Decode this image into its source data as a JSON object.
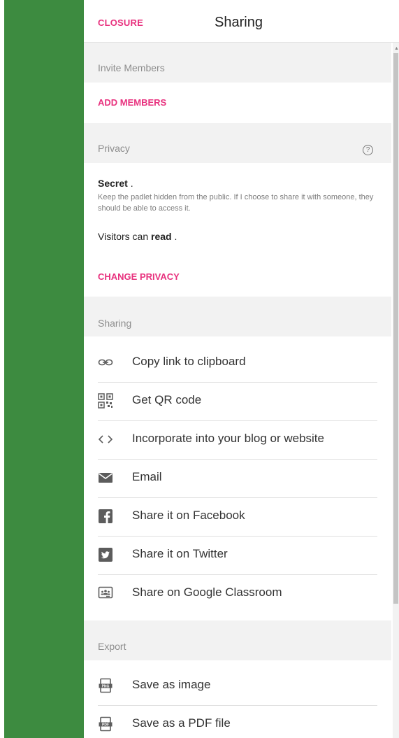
{
  "header": {
    "close_label": "CLOSURE",
    "title": "Sharing"
  },
  "invite": {
    "section_label": "Invite Members",
    "add_members": "ADD MEMBERS"
  },
  "privacy": {
    "section_label": "Privacy",
    "help_glyph": "?",
    "level": "Secret",
    "level_suffix": " .",
    "description": "Keep the padlet hidden from the public. If I choose to share it with someone, they should be able to access it.",
    "visitors_prefix": "Visitors can ",
    "visitors_value": "read",
    "visitors_suffix": " .",
    "change_label": "CHANGE PRIVACY"
  },
  "sharing": {
    "section_label": "Sharing",
    "items": [
      {
        "label": "Copy link to clipboard",
        "icon": "link-icon"
      },
      {
        "label": "Get QR code",
        "icon": "qr-code-icon"
      },
      {
        "label": "Incorporate into your blog or website",
        "icon": "code-icon"
      },
      {
        "label": "Email",
        "icon": "mail-icon"
      },
      {
        "label": "Share it on Facebook",
        "icon": "facebook-icon"
      },
      {
        "label": "Share it on Twitter",
        "icon": "twitter-icon"
      },
      {
        "label": "Share on Google Classroom",
        "icon": "google-classroom-icon"
      }
    ]
  },
  "export": {
    "section_label": "Export",
    "items": [
      {
        "label": "Save as image",
        "icon": "png-file-icon"
      },
      {
        "label": "Save as a PDF file",
        "icon": "pdf-file-icon"
      }
    ]
  },
  "colors": {
    "accent": "#e8317e",
    "sidebar": "#3d8b40",
    "section_bg": "#f2f2f2"
  }
}
